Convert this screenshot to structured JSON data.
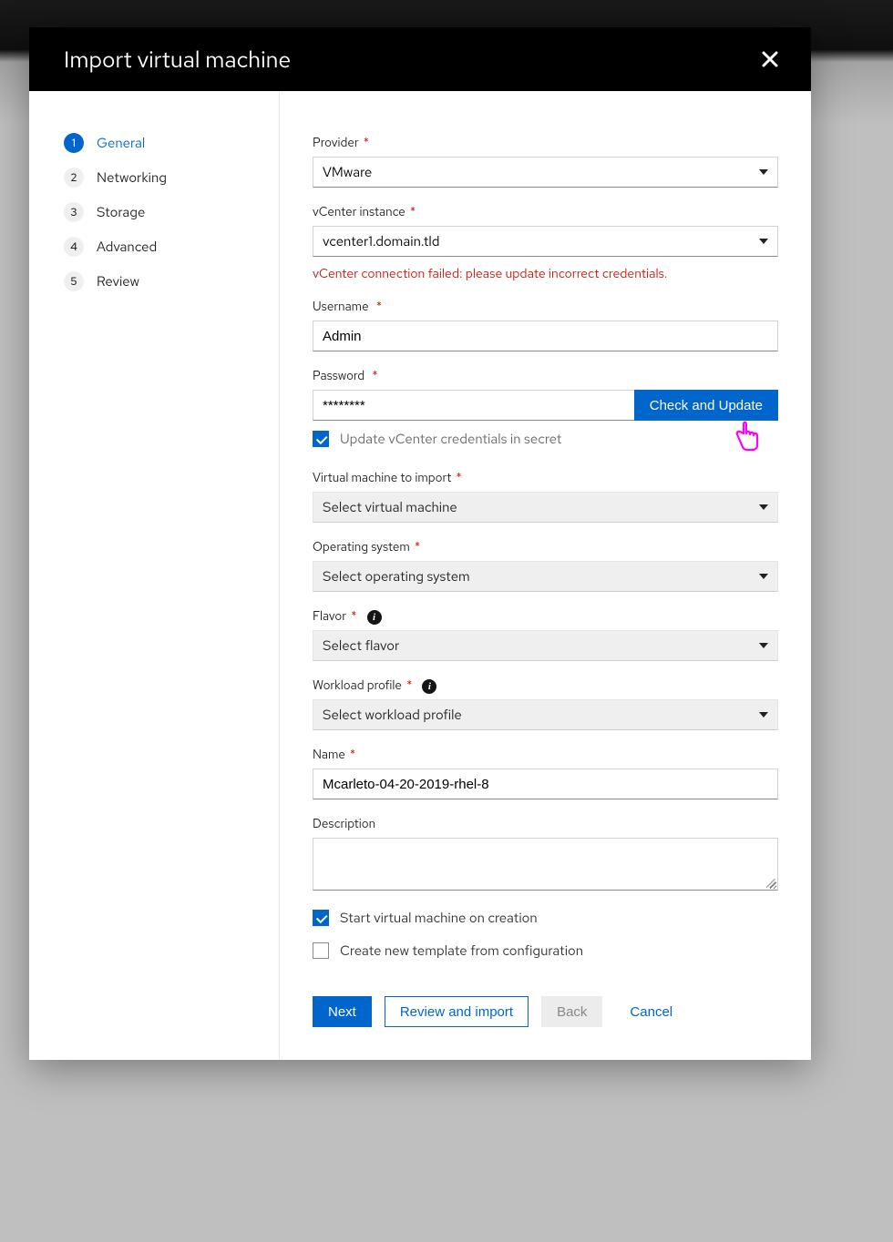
{
  "modal": {
    "title": "Import virtual machine"
  },
  "steps": [
    {
      "num": "1",
      "label": "General"
    },
    {
      "num": "2",
      "label": "Networking"
    },
    {
      "num": "3",
      "label": "Storage"
    },
    {
      "num": "4",
      "label": "Advanced"
    },
    {
      "num": "5",
      "label": "Review"
    }
  ],
  "form": {
    "provider": {
      "label": "Provider",
      "value": "VMware"
    },
    "vcenter": {
      "label": "vCenter instance",
      "value": "vcenter1.domain.tld",
      "error": "vCenter connection failed: please update incorrect credentials."
    },
    "username": {
      "label": "Username",
      "value": "Admin"
    },
    "password": {
      "label": "Password",
      "value": "********",
      "button": "Check and Update"
    },
    "update_secret": {
      "label": "Update vCenter credentials in secret"
    },
    "vm": {
      "label": "Virtual machine to import",
      "placeholder": "Select virtual machine"
    },
    "os": {
      "label": "Operating system",
      "placeholder": "Select operating system"
    },
    "flavor": {
      "label": "Flavor",
      "placeholder": "Select flavor"
    },
    "workload": {
      "label": "Workload profile",
      "placeholder": "Select workload profile"
    },
    "name": {
      "label": "Name",
      "value": "Mcarleto-04-20-2019-rhel-8"
    },
    "description": {
      "label": "Description",
      "value": ""
    },
    "start_vm": {
      "label": "Start virtual machine on creation"
    },
    "create_template": {
      "label": "Create new template from configuration"
    }
  },
  "footer": {
    "next": "Next",
    "review": "Review and import",
    "back": "Back",
    "cancel": "Cancel"
  },
  "info_glyph": "i"
}
